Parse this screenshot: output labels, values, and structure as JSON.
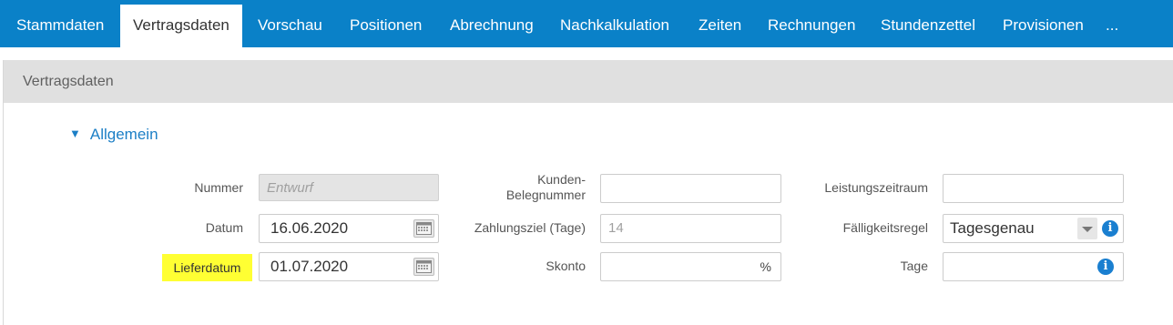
{
  "tabs": [
    {
      "label": "Stammdaten",
      "active": false
    },
    {
      "label": "Vertragsdaten",
      "active": true
    },
    {
      "label": "Vorschau",
      "active": false
    },
    {
      "label": "Positionen",
      "active": false
    },
    {
      "label": "Abrechnung",
      "active": false
    },
    {
      "label": "Nachkalkulation",
      "active": false
    },
    {
      "label": "Zeiten",
      "active": false
    },
    {
      "label": "Rechnungen",
      "active": false
    },
    {
      "label": "Stundenzettel",
      "active": false
    },
    {
      "label": "Provisionen",
      "active": false
    },
    {
      "label": "...",
      "active": false
    }
  ],
  "panel": {
    "title": "Vertragsdaten"
  },
  "section": {
    "title": "Allgemein",
    "expanded_icon": "triangle-down-icon"
  },
  "form": {
    "nummer": {
      "label": "Nummer",
      "placeholder": "Entwurf"
    },
    "datum": {
      "label": "Datum",
      "value": "16.06.2020"
    },
    "lieferdatum": {
      "label": "Lieferdatum",
      "value": "01.07.2020"
    },
    "kunden_belegnummer": {
      "label_line1": "Kunden-",
      "label_line2": "Belegnummer",
      "value": ""
    },
    "zahlungsziel": {
      "label": "Zahlungsziel (Tage)",
      "placeholder": "14"
    },
    "skonto": {
      "label": "Skonto",
      "unit": "%"
    },
    "leistungszeitraum": {
      "label": "Leistungszeitraum",
      "value": ""
    },
    "faelligkeitsregel": {
      "label": "Fälligkeitsregel",
      "value": "Tagesgenau"
    },
    "tage": {
      "label": "Tage",
      "value": ""
    }
  },
  "colors": {
    "tabbar": "#0a81c8",
    "highlight": "#ffff33",
    "accent": "#1c7fc6"
  }
}
